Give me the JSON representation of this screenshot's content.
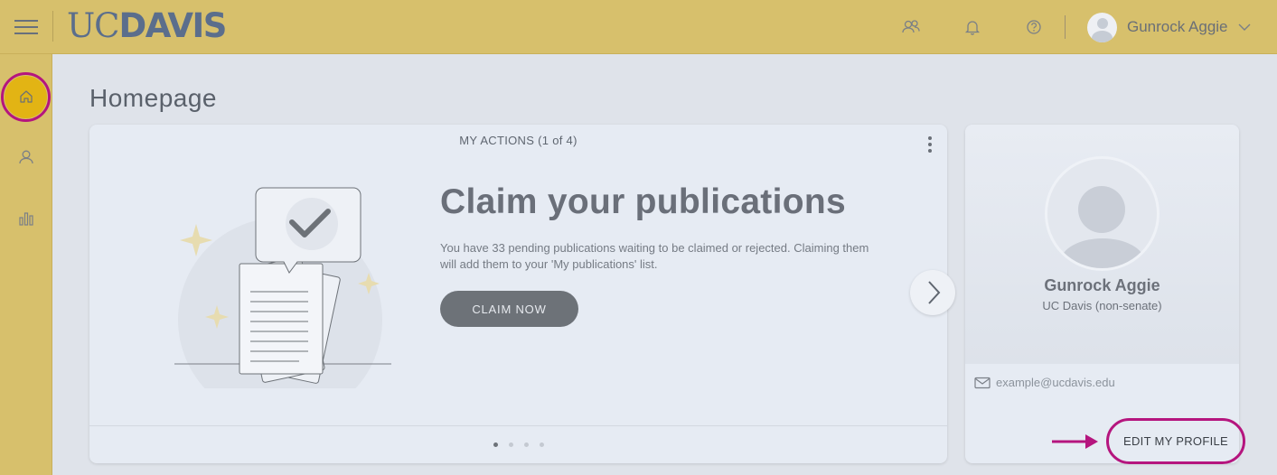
{
  "header": {
    "logo_uc": "UC",
    "logo_davis": "DAVIS",
    "icons": [
      "users-icon",
      "bell-icon",
      "help-icon"
    ],
    "user_name": "Gunrock Aggie"
  },
  "sidebar": {
    "items": [
      {
        "name": "home",
        "icon": "home-icon",
        "active": true
      },
      {
        "name": "profile",
        "icon": "person-icon",
        "active": false
      },
      {
        "name": "analytics",
        "icon": "bar-chart-icon",
        "active": false
      }
    ]
  },
  "page": {
    "title": "Homepage"
  },
  "actions": {
    "header": "MY ACTIONS (1 of 4)",
    "title": "Claim your publications",
    "text": "You have 33 pending publications waiting to be claimed or rejected. Claiming them will add them to your 'My publications' list.",
    "button": "CLAIM NOW",
    "current_slide": 1,
    "total_slides": 4
  },
  "profile": {
    "name": "Gunrock Aggie",
    "org": "UC Davis (non-senate)",
    "email": "example@ucdavis.edu",
    "edit_button": "EDIT MY PROFILE"
  },
  "colors": {
    "highlight": "#b5157e",
    "topbar": "#d7c06c",
    "active_home": "#e2b414"
  }
}
